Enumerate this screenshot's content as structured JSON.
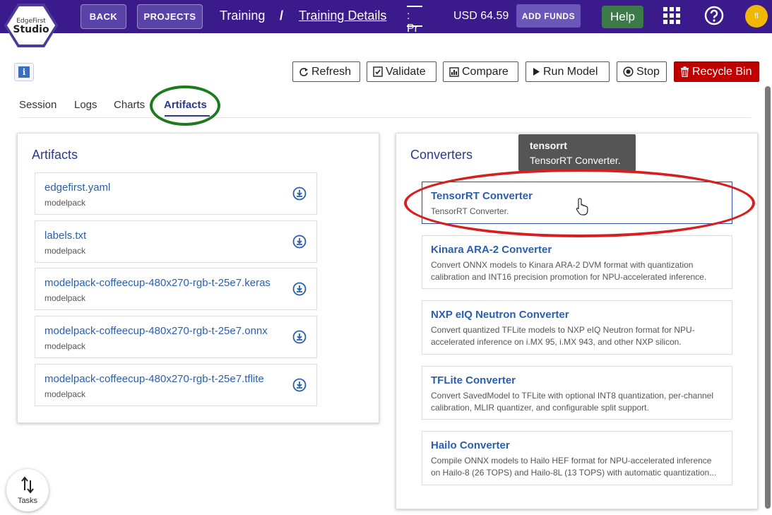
{
  "header": {
    "logo_line1": "EdgeFirst",
    "logo_line2": "Studio",
    "back_label": "BACK",
    "projects_label": "PROJECTS",
    "breadcrumb_1": "Training",
    "separator": "/",
    "breadcrumb_2": "Training Details",
    "truncated_text": ": Pr",
    "balance": "USD 64.59",
    "add_funds_label": "ADD FUNDS",
    "help_label": "Help",
    "avatar_initials": "fl",
    "accent_color": "#3b1a8c"
  },
  "toolbar": {
    "refresh": "Refresh",
    "validate": "Validate",
    "compare": "Compare",
    "run_model": "Run Model",
    "stop": "Stop",
    "recycle_bin": "Recycle Bin"
  },
  "info_icon": "i",
  "tabs": {
    "session": "Session",
    "logs": "Logs",
    "charts": "Charts",
    "artifacts": "Artifacts",
    "active": "Artifacts"
  },
  "artifacts": {
    "title": "Artifacts",
    "items": [
      {
        "name": "edgefirst.yaml",
        "type": "modelpack"
      },
      {
        "name": "labels.txt",
        "type": "modelpack"
      },
      {
        "name": "modelpack-coffeecup-480x270-rgb-t-25e7.keras",
        "type": "modelpack"
      },
      {
        "name": "modelpack-coffeecup-480x270-rgb-t-25e7.onnx",
        "type": "modelpack"
      },
      {
        "name": "modelpack-coffeecup-480x270-rgb-t-25e7.tflite",
        "type": "modelpack"
      }
    ]
  },
  "converters": {
    "title": "Converters",
    "items": [
      {
        "name": "TensorRT Converter",
        "desc": "TensorRT Converter."
      },
      {
        "name": "Kinara ARA-2 Converter",
        "desc": "Convert ONNX models to Kinara ARA-2 DVM format with quantization calibration and INT16 precision promotion for NPU-accelerated inference."
      },
      {
        "name": "NXP eIQ Neutron Converter",
        "desc": "Convert quantized TFLite models to NXP eIQ Neutron format for NPU-accelerated inference on i.MX 95, i.MX 943, and other NXP silicon."
      },
      {
        "name": "TFLite Converter",
        "desc": "Convert SavedModel to TFLite with optional INT8 quantization, per-channel calibration, MLIR quantizer, and configurable split support."
      },
      {
        "name": "Hailo Converter",
        "desc": "Compile ONNX models to Hailo HEF format for NPU-accelerated inference on Hailo-8 (26 TOPS) and Hailo-8L (13 TOPS) with automatic quantization..."
      }
    ]
  },
  "tooltip": {
    "title": "tensorrt",
    "text": "TensorRT Converter."
  },
  "tasks_label": "Tasks"
}
